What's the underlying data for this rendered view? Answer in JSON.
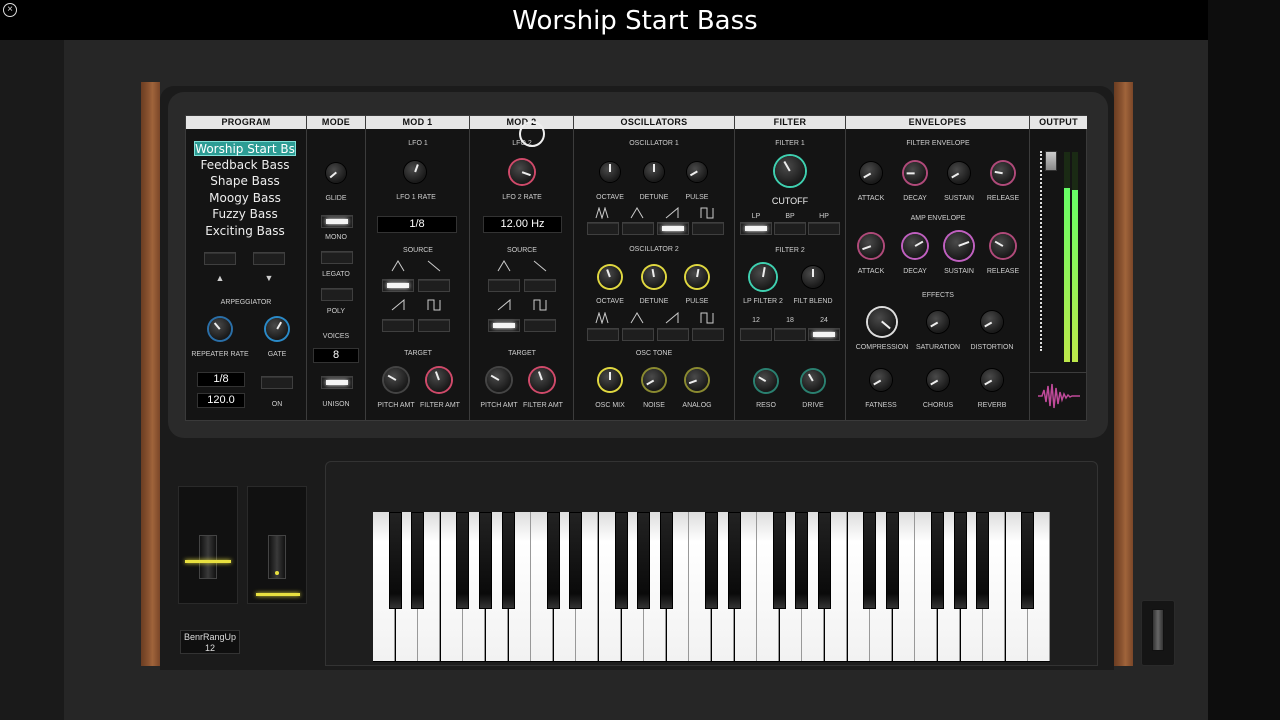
{
  "title": "Worship Start Bass",
  "close_label": "×",
  "sections": {
    "program": "PROGRAM",
    "mode": "MODE",
    "mod1": "MOD 1",
    "mod2": "MOD 2",
    "oscillators": "OSCILLATORS",
    "filter": "FILTER",
    "envelopes": "ENVELOPES",
    "output": "OUTPUT"
  },
  "program": {
    "presets": [
      "Worship Start Bs",
      "Feedback Bass",
      "Shape Bass",
      "Moogy Bass",
      "Fuzzy Bass",
      "Exciting Bass"
    ],
    "selected_index": 0,
    "up_arrow": "▲",
    "down_arrow": "▼",
    "arpeggiator_label": "ARPEGGIATOR",
    "repeater_rate_label": "REPEATER RATE",
    "gate_label": "GATE",
    "rate_value": "1/8",
    "bpm_value": "120.0",
    "on_label": "ON"
  },
  "mode": {
    "glide": "GLIDE",
    "mono": "MONO",
    "legato": "LEGATO",
    "poly": "POLY",
    "voices": "VOICES",
    "voices_value": "8",
    "unison": "UNISON"
  },
  "mod1": {
    "lfo": "LFO 1",
    "rate_label": "LFO 1 RATE",
    "rate_value": "1/8",
    "source": "SOURCE",
    "target": "TARGET",
    "pitch_amt": "PITCH AMT",
    "filter_amt": "FILTER AMT"
  },
  "mod2": {
    "lfo": "LFO 2",
    "rate_label": "LFO 2 RATE",
    "rate_value": "12.00 Hz",
    "source": "SOURCE",
    "target": "TARGET",
    "pitch_amt": "PITCH AMT",
    "filter_amt": "FILTER AMT"
  },
  "oscillators": {
    "osc1": "OSCILLATOR 1",
    "osc2": "OSCILLATOR 2",
    "octave": "OCTAVE",
    "detune": "DETUNE",
    "pulse": "PULSE",
    "osc_tone": "OSC TONE",
    "osc_mix": "OSC MIX",
    "noise": "NOISE",
    "analog": "ANALOG"
  },
  "filter": {
    "filter1": "FILTER 1",
    "cutoff": "CUTOFF",
    "lp": "LP",
    "bp": "BP",
    "hp": "HP",
    "filter2": "FILTER 2",
    "lp_filter2": "LP FILTER 2",
    "filt_blend": "FILT BLEND",
    "slope_12": "12",
    "slope_18": "18",
    "slope_24": "24",
    "reso": "RESO",
    "drive": "DRIVE"
  },
  "envelopes": {
    "filter_env": "FILTER ENVELOPE",
    "amp_env": "AMP ENVELOPE",
    "attack": "ATTACK",
    "decay": "DECAY",
    "sustain": "SUSTAIN",
    "release": "RELEASE",
    "effects": "EFFECTS",
    "compression": "COMPRESSION",
    "saturation": "SATURATION",
    "distortion": "DISTORTION",
    "fatness": "FATNESS",
    "chorus": "CHORUS",
    "reverb": "REVERB"
  },
  "pitch_info": {
    "label": "BenrRangUp",
    "value": "12"
  },
  "colors": {
    "accent": "#2d9c94",
    "pink": "#e0507a",
    "yellow": "#e8e040",
    "teal": "#3fd0b0",
    "purple": "#c060c0",
    "meter": "#9be84a"
  }
}
